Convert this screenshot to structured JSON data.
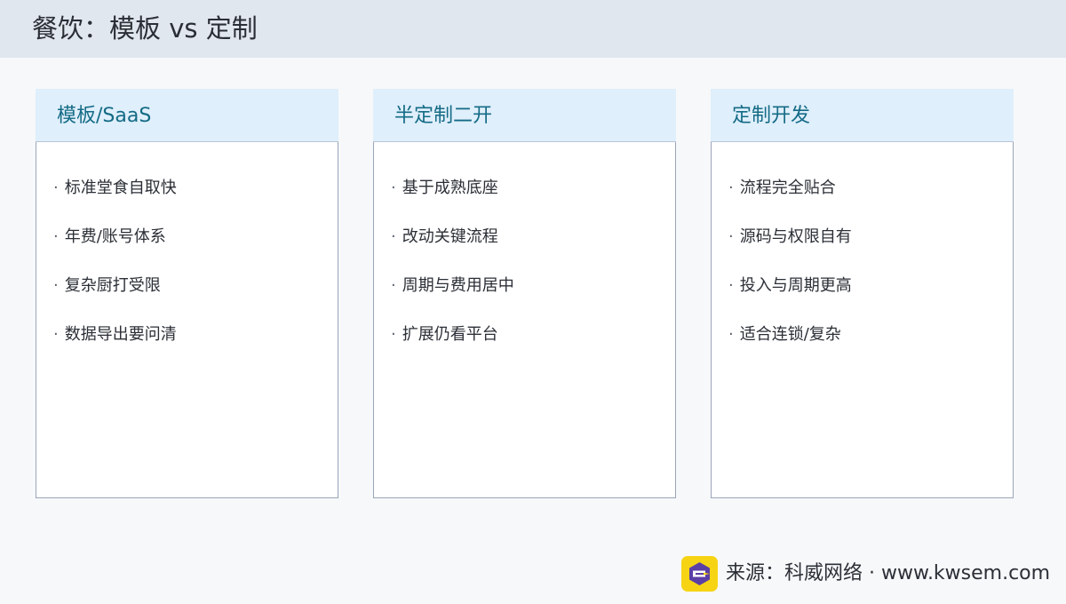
{
  "header": {
    "title": "餐饮：模板 vs 定制"
  },
  "cards": [
    {
      "title": "模板/SaaS",
      "items": [
        "标准堂食自取快",
        "年费/账号体系",
        "复杂厨打受限",
        "数据导出要问清"
      ]
    },
    {
      "title": "半定制二开",
      "items": [
        "基于成熟底座",
        "改动关键流程",
        "周期与费用居中",
        "扩展仍看平台"
      ]
    },
    {
      "title": "定制开发",
      "items": [
        "流程完全贴合",
        "源码与权限自有",
        "投入与周期更高",
        "适合连锁/复杂"
      ]
    }
  ],
  "footer": {
    "source": "来源：科威网络 · www.kwsem.com",
    "logo_icon": "kwsem-logo-icon"
  },
  "colors": {
    "header_bg": "#e1e7ef",
    "card_head_bg": "#dfeffb",
    "card_title": "#146b86",
    "logo_bg": "#f6d414"
  }
}
